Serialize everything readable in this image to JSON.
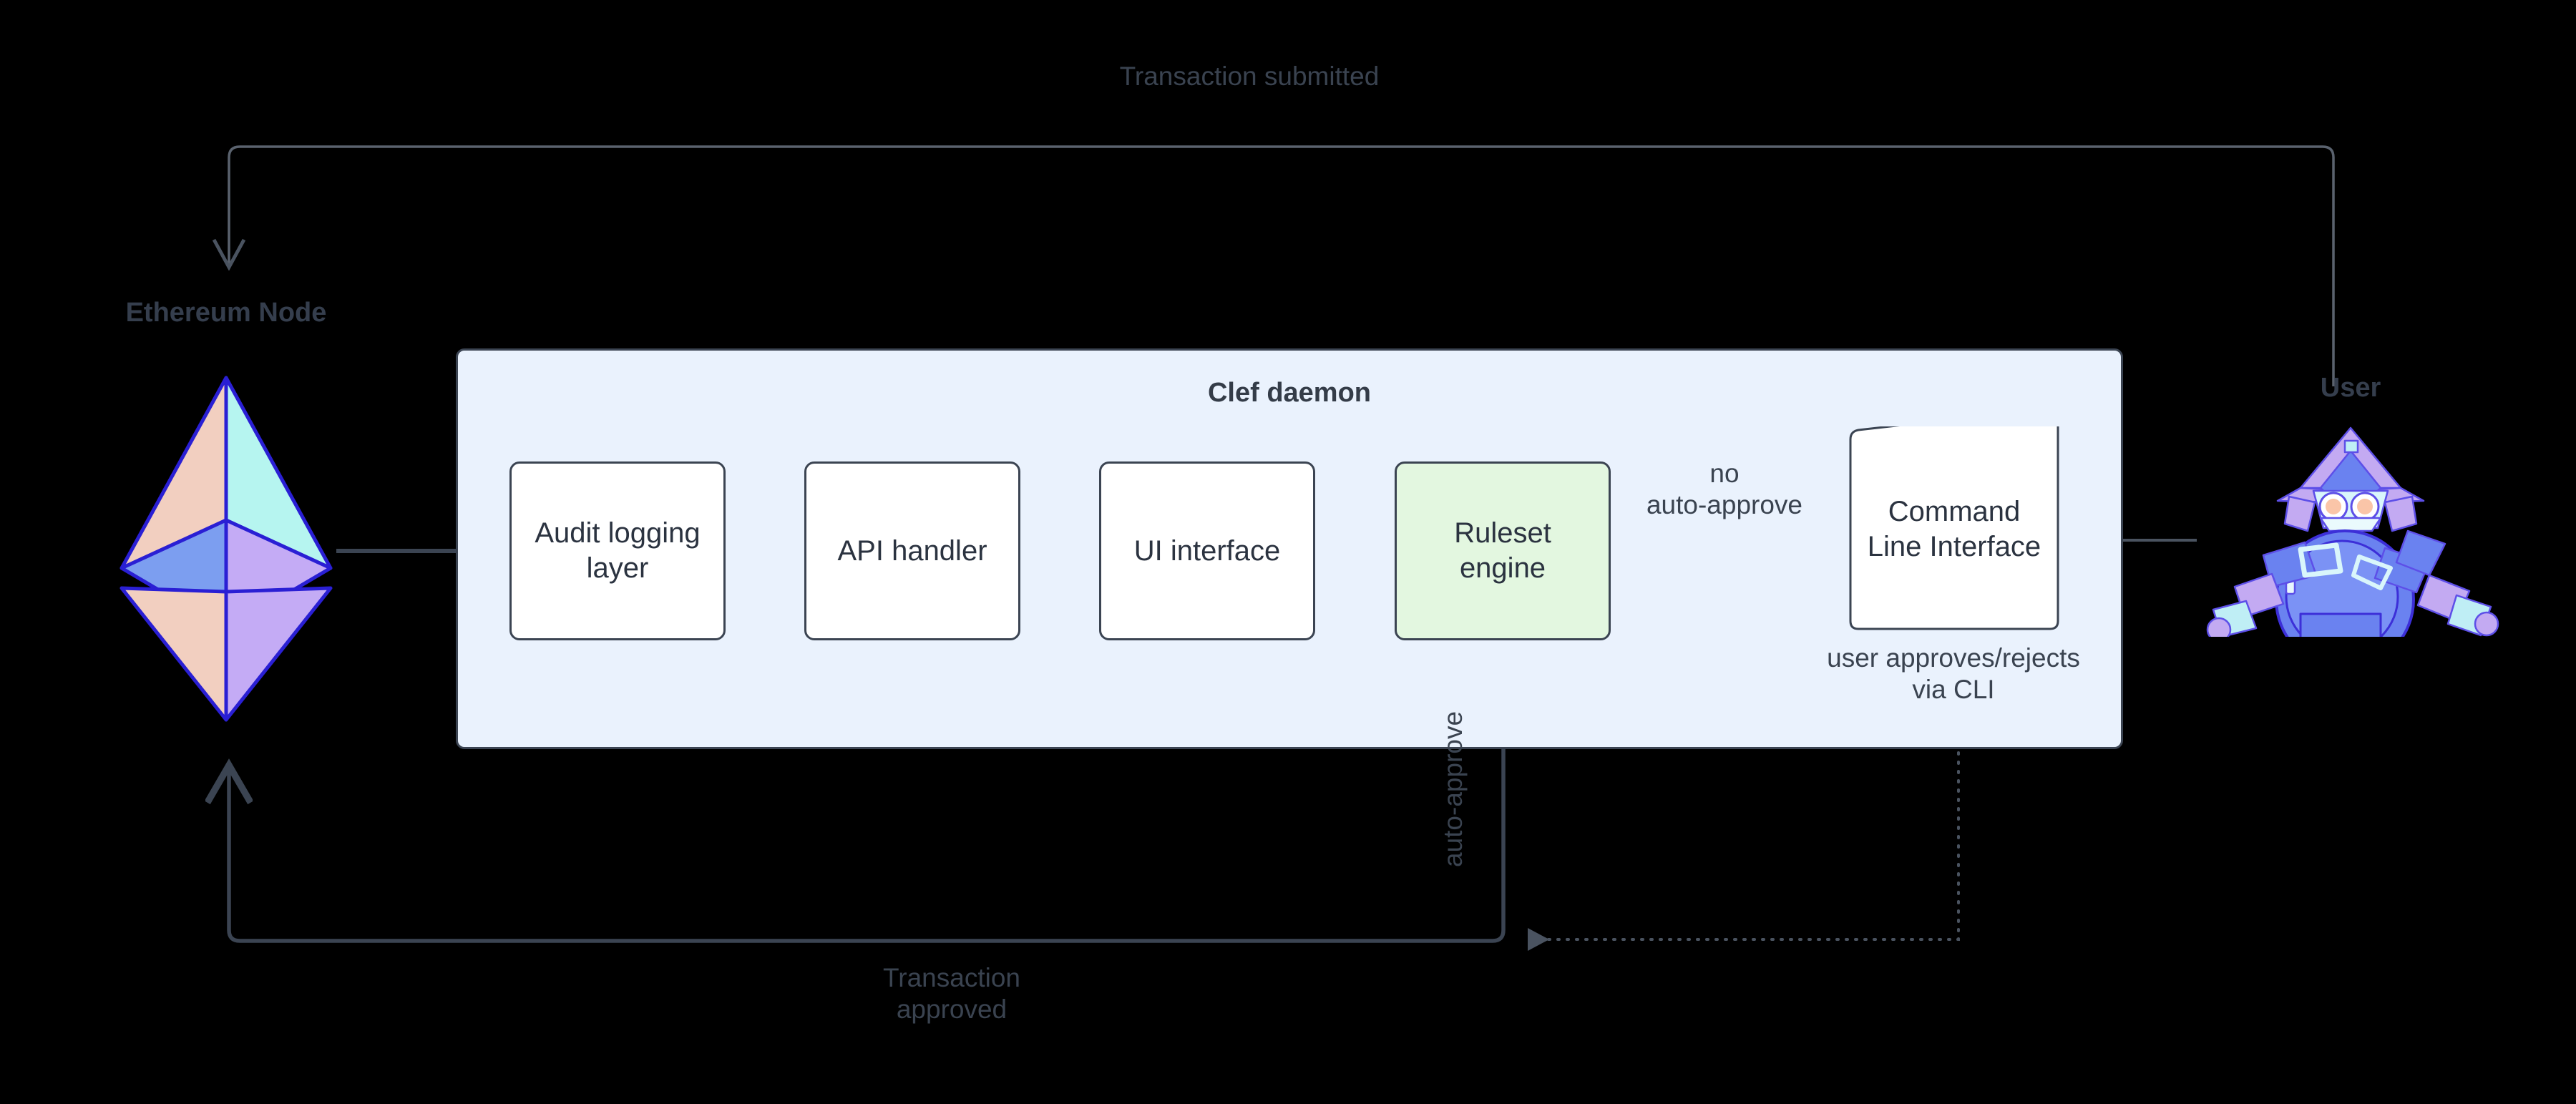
{
  "diagram": {
    "type": "flow",
    "background": "#000000",
    "accent_container": "#eaf2fd",
    "accent_highlight": "#e3f7e0",
    "stroke": "#3b4452",
    "text": "#343c48"
  },
  "actors": {
    "left": {
      "label": "Ethereum Node",
      "icon": "ethereum-logo-icon"
    },
    "right": {
      "label": "User",
      "icon": "robot-user-icon"
    }
  },
  "container": {
    "title": "Clef daemon"
  },
  "nodes": [
    {
      "id": "audit",
      "label": "Audit logging\nlayer",
      "fill": "#ffffff",
      "shape": "rounded-rect"
    },
    {
      "id": "api",
      "label": "API handler",
      "fill": "#ffffff",
      "shape": "rounded-rect"
    },
    {
      "id": "ui",
      "label": "UI interface",
      "fill": "#ffffff",
      "shape": "rounded-rect"
    },
    {
      "id": "ruleset",
      "label": "Ruleset\nengine",
      "fill": "#e3f7e0",
      "shape": "rounded-rect"
    },
    {
      "id": "cli",
      "label": "Command\nLine Interface",
      "fill": "#ffffff",
      "shape": "skewed-rect"
    }
  ],
  "edges": {
    "top": {
      "label": "Transaction submitted",
      "from": "User",
      "to": "Ethereum Node",
      "style": "solid-thin"
    },
    "bottom": {
      "label": "Transaction\napproved",
      "from": "Ruleset engine",
      "to": "Ethereum Node",
      "style": "solid-thick"
    },
    "ruleset_to_cli": {
      "label": "no\nauto-approve",
      "style": "solid-thick"
    },
    "ruleset_down": {
      "label": "auto-approve",
      "orientation": "vertical",
      "style": "solid-thick"
    },
    "cli_feedback": {
      "label": "user approves/rejects\nvia CLI",
      "style": "dotted"
    }
  }
}
